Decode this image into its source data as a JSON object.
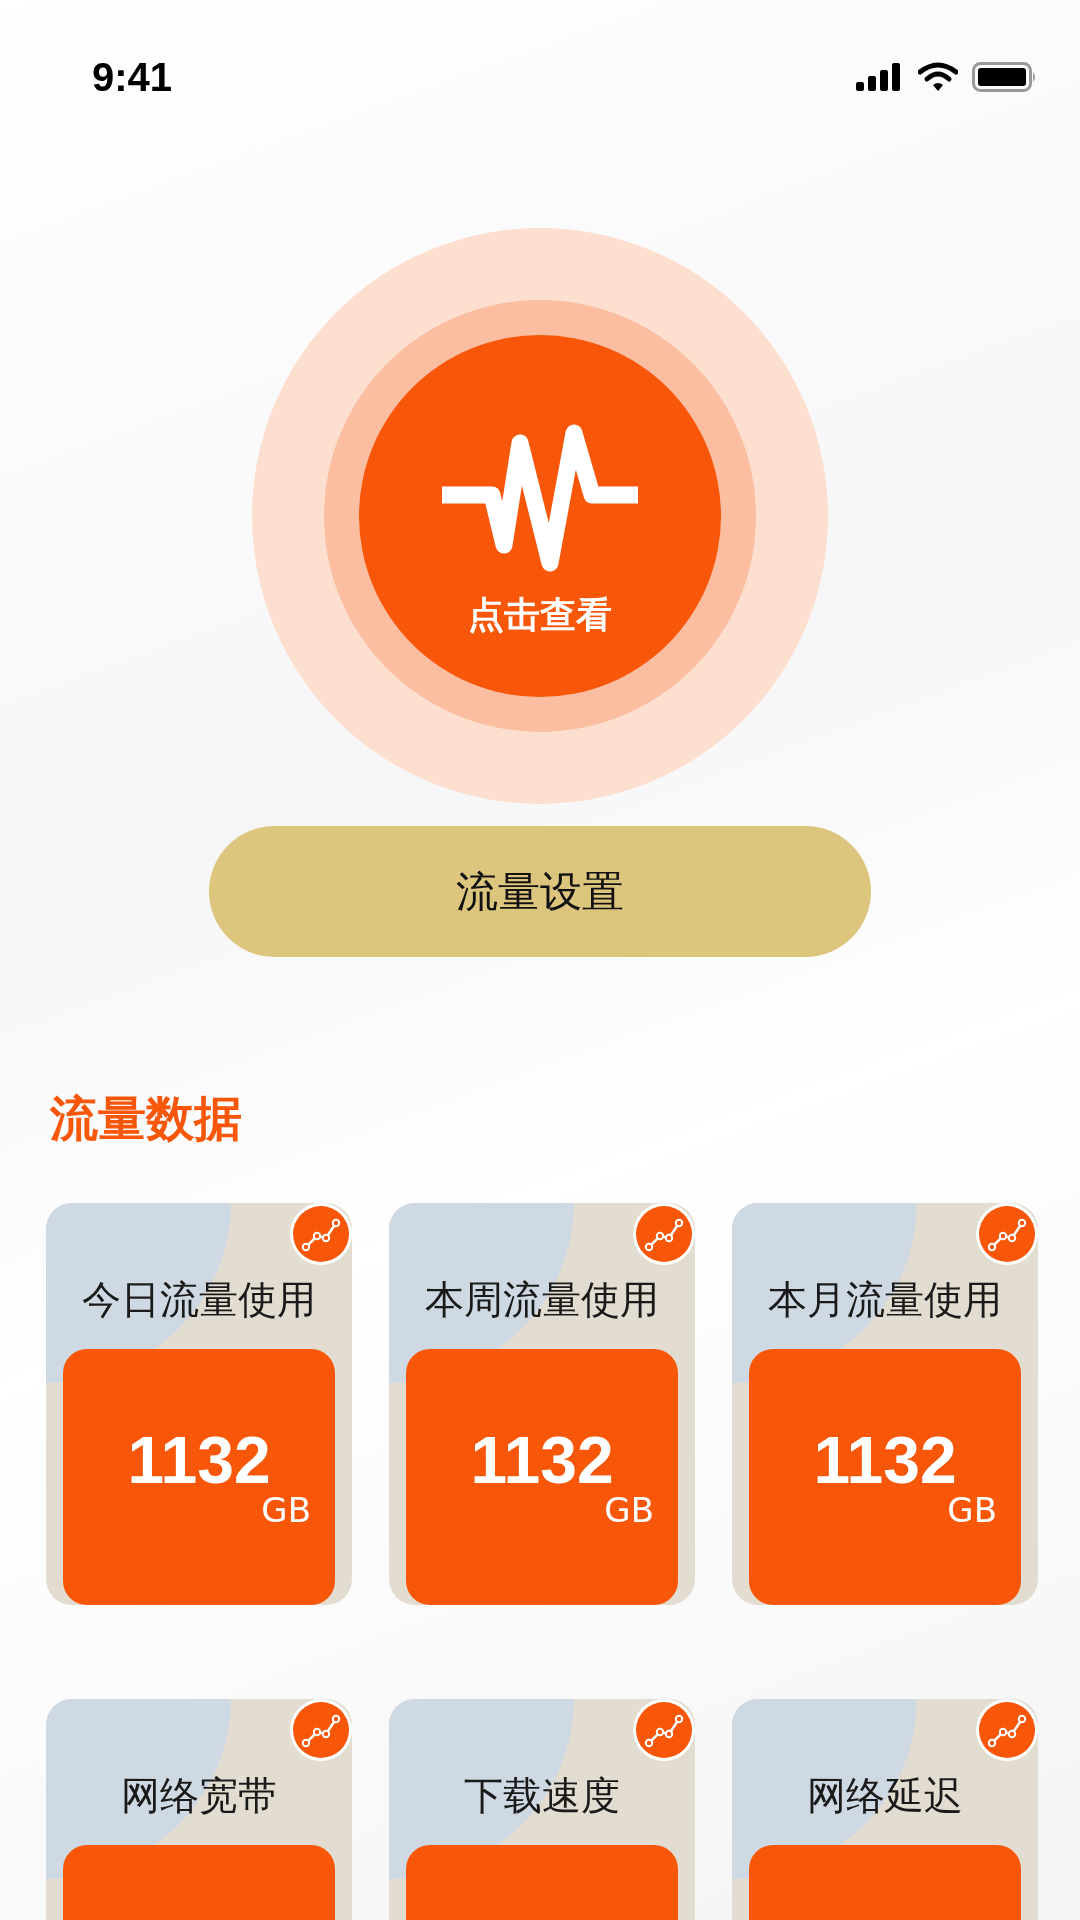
{
  "status_bar": {
    "time": "9:41"
  },
  "hero": {
    "label": "点击查看"
  },
  "settings_button": {
    "label": "流量设置"
  },
  "section": {
    "title": "流量数据"
  },
  "cards": [
    {
      "title": "今日流量使用",
      "value": "1132",
      "unit": "GB"
    },
    {
      "title": "本周流量使用",
      "value": "1132",
      "unit": "GB"
    },
    {
      "title": "本月流量使用",
      "value": "1132",
      "unit": "GB"
    },
    {
      "title": "网络宽带"
    },
    {
      "title": "下载速度"
    },
    {
      "title": "网络延迟"
    }
  ]
}
